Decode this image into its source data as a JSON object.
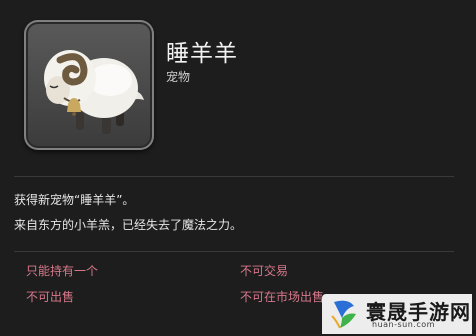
{
  "item": {
    "icon": "sheep-minion-icon",
    "name": "睡羊羊",
    "category": "宠物"
  },
  "description": {
    "line1": "获得新宠物“睡羊羊”。",
    "line2": "来自东方的小羊羔，已经失去了魔法之力。"
  },
  "restrictions": {
    "unique": "只能持有一个",
    "untradable": "不可交易",
    "unsellable": "不可出售",
    "no_market": "不可在市场出售"
  },
  "colors": {
    "restriction_text": "#d8788a",
    "background": "#1d1d1d"
  },
  "watermark": {
    "logo": "kite-logo-icon",
    "text": "寰晟手游网",
    "url": "huan-sun.com"
  }
}
